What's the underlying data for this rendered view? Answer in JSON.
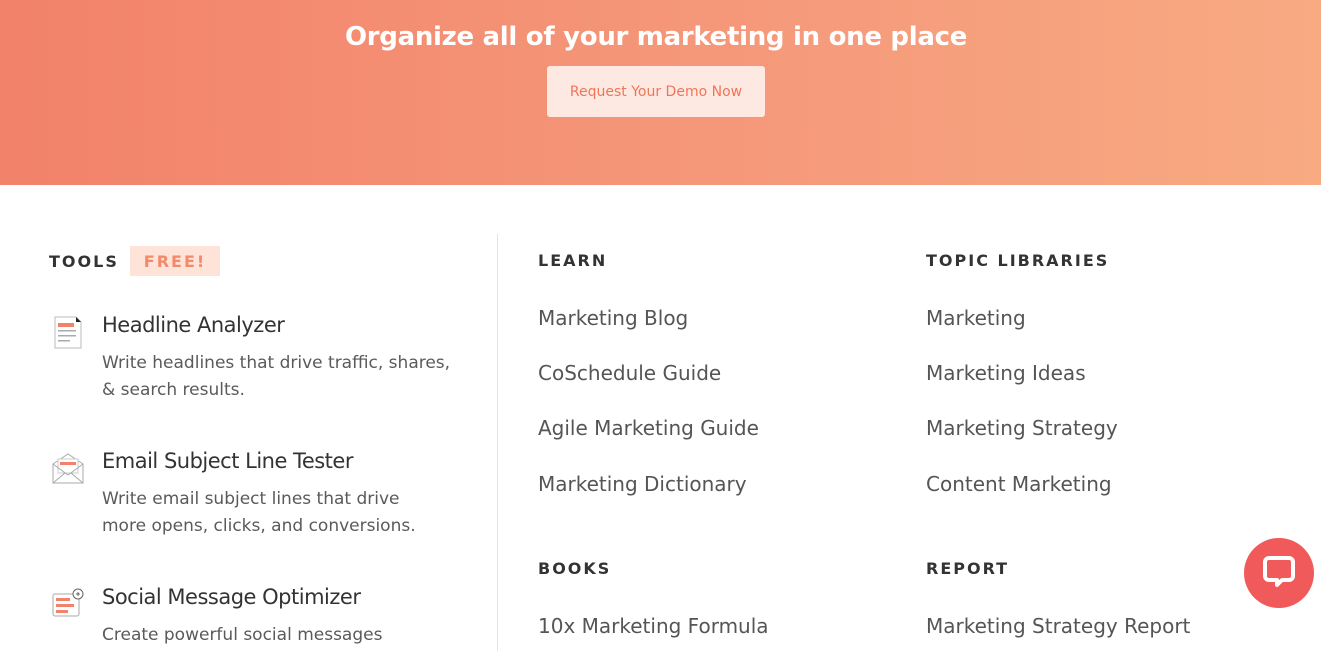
{
  "hero": {
    "title": "Organize all of your marketing in one place",
    "button_label": "Request Your Demo Now"
  },
  "tools": {
    "heading": "TOOLS",
    "badge": "FREE!",
    "items": [
      {
        "title": "Headline Analyzer",
        "desc_line1": "Write headlines that drive traffic, shares,",
        "desc_line2": "& search results.",
        "icon": "headline-document-icon"
      },
      {
        "title": "Email Subject Line Tester",
        "desc_line1": "Write email subject lines that drive",
        "desc_line2": "more opens, clicks, and conversions.",
        "icon": "email-envelope-icon"
      },
      {
        "title": "Social Message Optimizer",
        "desc_line1": "Create powerful social messages",
        "desc_line2": "",
        "icon": "social-message-icon"
      }
    ]
  },
  "learn": {
    "heading": "LEARN",
    "links": [
      "Marketing Blog",
      "CoSchedule Guide",
      "Agile Marketing Guide",
      "Marketing Dictionary"
    ]
  },
  "topic_libraries": {
    "heading": "TOPIC LIBRARIES",
    "links": [
      "Marketing",
      "Marketing Ideas",
      "Marketing Strategy",
      "Content Marketing"
    ]
  },
  "books": {
    "heading": "BOOKS",
    "links": [
      "10x Marketing Formula"
    ]
  },
  "report": {
    "heading": "REPORT",
    "links": [
      "Marketing Strategy Report"
    ]
  },
  "chat": {
    "icon": "chat-bubble-icon"
  },
  "colors": {
    "accent": "#f2826a",
    "badge_bg": "#fde3d8",
    "chat": "#f05a5a"
  }
}
